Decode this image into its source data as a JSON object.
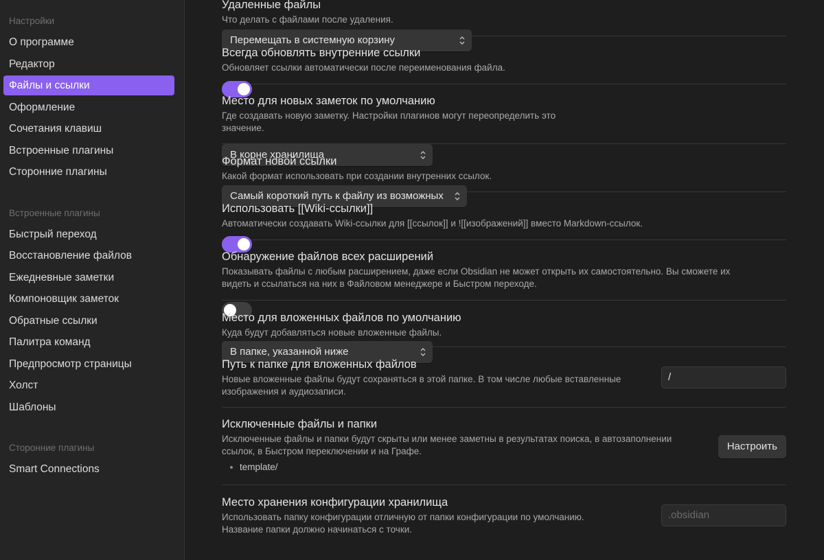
{
  "sidebar": {
    "groups": [
      {
        "title": "Настройки",
        "items": [
          "О программе",
          "Редактор",
          "Файлы и ссылки",
          "Оформление",
          "Сочетания клавиш",
          "Встроенные плагины",
          "Сторонние плагины"
        ]
      },
      {
        "title": "Встроенные плагины",
        "items": [
          "Быстрый переход",
          "Восстановление файлов",
          "Ежедневные заметки",
          "Компоновщик заметок",
          "Обратные ссылки",
          "Палитра команд",
          "Предпросмотр страницы",
          "Холст",
          "Шаблоны"
        ]
      },
      {
        "title": "Сторонние плагины",
        "items": [
          "Smart Connections"
        ]
      }
    ],
    "active_item": "Файлы и ссылки"
  },
  "settings": {
    "deleted_files": {
      "name": "Удаленные файлы",
      "desc": "Что делать с файлами после удаления.",
      "value": "Перемещать в системную корзину"
    },
    "update_links": {
      "name": "Всегда обновлять внутренние ссылки",
      "desc": "Обновляет ссылки автоматически после переименования файла.",
      "enabled": true
    },
    "new_note_location": {
      "name": "Место для новых заметок по умолчанию",
      "desc": "Где создавать новую заметку. Настройки плагинов могут переопределить это значение.",
      "value": "В корне хранилища"
    },
    "link_format": {
      "name": "Формат новой ссылки",
      "desc": "Какой формат использовать при создании внутренних ссылок.",
      "value": "Самый короткий путь к файлу из возможных"
    },
    "wiki_links": {
      "name": "Использовать [[Wiki-ссылки]]",
      "desc": "Автоматически создавать Wiki-ссылки для [[ссылок]] и ![[изображений]] вместо Markdown-ссылок.",
      "enabled": true
    },
    "all_extensions": {
      "name": "Обнаружение файлов всех расширений",
      "desc": "Показывать файлы с любым расширением, даже если Obsidian не может открыть их самостоятельно. Вы сможете их видеть и ссылаться на них в Файловом менеджере и Быстром переходе.",
      "enabled": false
    },
    "attachment_location": {
      "name": "Место для вложенных файлов по умолчанию",
      "desc": "Куда будут добавляться новые вложенные файлы.",
      "value": "В папке, указанной ниже"
    },
    "attachment_path": {
      "name": "Путь к папке для вложенных файлов",
      "desc": "Новые вложенные файлы будут сохраняться в этой папке. В том числе любые вставленные изображения и аудиозаписи.",
      "value": "/"
    },
    "excluded_files": {
      "name": "Исключенные файлы и папки",
      "desc": "Исключенные файлы и папки будут скрыты или менее заметны в результатах поиска, в автозаполнении ссылок, в Быстром переключении и на Графе.",
      "items": [
        "template/"
      ],
      "button_label": "Настроить"
    },
    "config_folder": {
      "name": "Место хранения конфигурации хранилища",
      "desc": "Использовать папку конфигурации отличную от папки конфигурации по умолчанию. Название папки должно начинаться с точки.",
      "placeholder": ".obsidian"
    }
  },
  "colors": {
    "accent": "#8a60ee",
    "sidebar_bg": "#252525",
    "content_bg": "#1e1e1e"
  }
}
